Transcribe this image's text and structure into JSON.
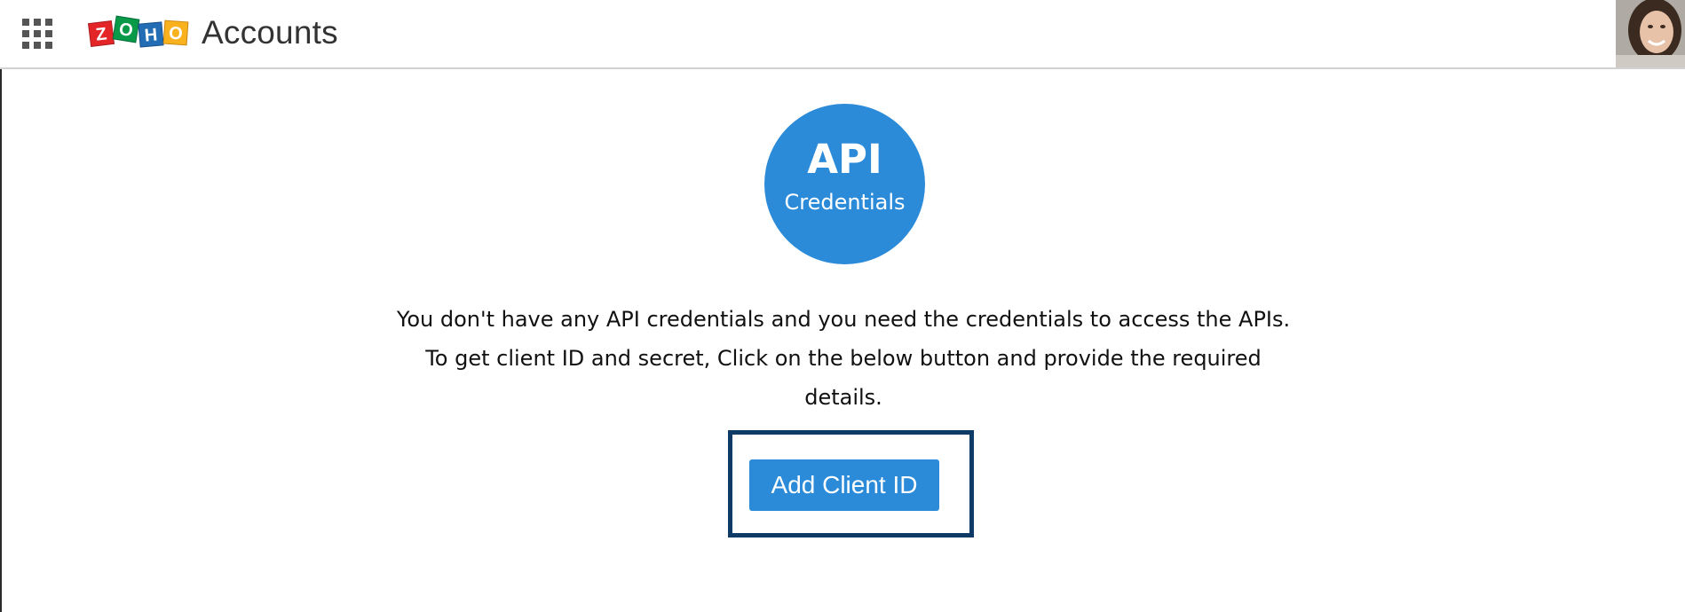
{
  "header": {
    "app_title": "Accounts",
    "logo_text": "ZOHO",
    "logo_letters": [
      {
        "letter": "Z",
        "color": "#e42527"
      },
      {
        "letter": "O",
        "color": "#089949"
      },
      {
        "letter": "H",
        "color": "#226db4"
      },
      {
        "letter": "O",
        "color": "#f9b21d"
      }
    ]
  },
  "hero": {
    "line1": "API",
    "line2": "Credentials",
    "color": "#2b8bd9"
  },
  "main": {
    "message": "You don't have any API credentials and you need the credentials to access the APIs. To get client ID and secret, Click on the below button and provide the required details.",
    "add_button_label": "Add Client ID"
  },
  "icons": {
    "apps": "apps-grid-icon",
    "avatar": "user-avatar"
  },
  "colors": {
    "accent": "#2b8bd9",
    "highlight_border": "#0d3b66"
  }
}
